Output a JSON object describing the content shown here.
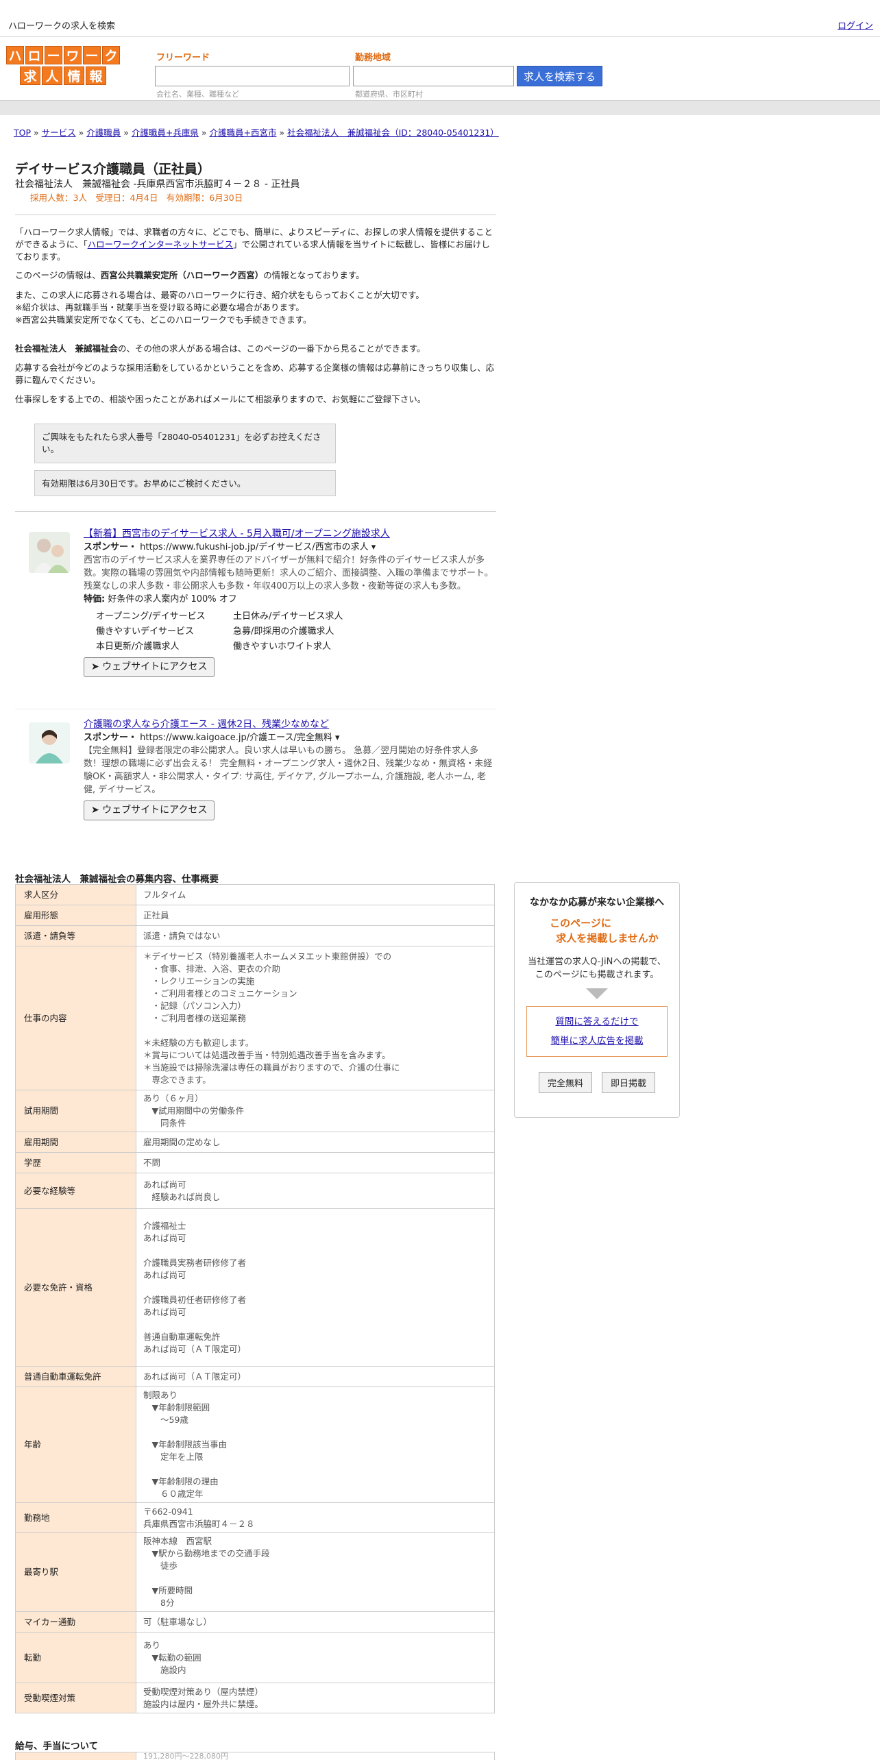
{
  "header": {
    "search_title": "ハローワークの求人を検索",
    "login": "ログイン"
  },
  "logo": {
    "row1": [
      "ハ",
      "ロ",
      "ー",
      "ワ",
      "ー",
      "ク"
    ],
    "row2": [
      "求",
      "人",
      "情",
      "報"
    ]
  },
  "search": {
    "keyword_label": "フリーワード",
    "keyword_hint": "会社名、業種、職種など",
    "area_label": "勤務地域",
    "area_hint": "都道府県、市区町村",
    "button": "求人を検索する"
  },
  "breadcrumb": {
    "items": [
      "TOP",
      "サービス",
      "介護職員",
      "介護職員+兵庫県",
      "介護職員+西宮市",
      "社会福祉法人　兼誠福祉会（ID：28040-05401231）"
    ],
    "sep": " » "
  },
  "job": {
    "title": "デイサービス介護職員（正社員）",
    "subtitle": "社会福祉法人　兼誠福祉会 -兵庫県西宮市浜脇町４－２８ - 正社員",
    "meta": "採用人数：3人　受理日：4月4日　有効期限：6月30日"
  },
  "intro": {
    "p1a": "「ハローワーク求人情報」では、求職者の方々に、どこでも、簡単に、よりスピーディに、お探しの求人情報を提供することができるように、「",
    "p1link": "ハローワークインターネットサービス",
    "p1b": "」で公開されている求人情報を当サイトに転載し、皆様にお届けしております。",
    "p2a": "このページの情報は、",
    "p2b": "西宮公共職業安定所（ハローワーク西宮）",
    "p2c": "の情報となっております。",
    "p3": "また、この求人に応募される場合は、最寄のハローワークに行き、紹介状をもらっておくことが大切です。",
    "p4": "※紹介状は、再就職手当・就業手当を受け取る時に必要な場合があります。",
    "p5": "※西宮公共職業安定所でなくても、どこのハローワークでも手続きできます。",
    "p6a": "社会福祉法人　兼誠福祉会",
    "p6b": "の、その他の求人がある場合は、このページの一番下から見ることができます。",
    "p7": "応募する会社が今どのような採用活動をしているかということを含め、応募する企業様の情報は応募前にきっちり収集し、応募に臨んでください。",
    "p8": "仕事探しをする上での、相談や困ったことがあればメールにて相談承りますので、お気軽にご登録下さい。"
  },
  "notices": [
    "ご興味をもたれたら求人番号「28040-05401231」を必ずお控えください。",
    "有効期限は6月30日です。お早めにご検討ください。"
  ],
  "ads": [
    {
      "title": "【新着】西宮市のデイサービス求人 - 5月入職可/オープニング施設求人",
      "sponsor_label": "スポンサー・",
      "sponsor_url": "https://www.fukushi-job.jp/デイサービス/西宮市の求人 ▾",
      "desc": "西宮市のデイサービス求人を業界専任のアドバイザーが無料で紹介！好条件のデイサービス求人が多数。実際の職場の雰囲気や内部情報も随時更新！求人のご紹介、面接調整、入職の準備までサポート。 残業なしの求人多数・非公開求人も多数・年収400万以上の求人多数・夜勤等従の求人も多数。",
      "feature_label": "特価:",
      "feature": " 好条件の求人案内が 100% オフ",
      "links": [
        "オープニング/デイサービス",
        "土日休み/デイサービス求人",
        "働きやすいデイサービス",
        "急募/即採用の介護職求人",
        "本日更新/介護職求人",
        "働きやすいホワイト求人"
      ],
      "button": "➤ ウェブサイトにアクセス"
    },
    {
      "title": "介護職の求人なら介護エース - 週休2日、残業少なめなど",
      "sponsor_label": "スポンサー・",
      "sponsor_url": "https://www.kaigoace.jp/介護エース/完全無料 ▾",
      "desc": "【完全無料】登録者限定の非公開求人。良い求人は早いもの勝ち。 急募／翌月開始の好条件求人多数！理想の職場に必ず出会える！ 完全無料・オープニング求人・週休2日、残業少なめ・無資格・未経験OK・高額求人・非公開求人・タイプ: サ高住, デイケア, グループホーム, 介護施設, 老人ホーム, 老健, デイサービス。",
      "button": "➤ ウェブサイトにアクセス"
    }
  ],
  "details_title": "社会福祉法人　兼誠福祉会の募集内容、仕事概要",
  "details": [
    {
      "k": "求人区分",
      "v": "フルタイム"
    },
    {
      "k": "雇用形態",
      "v": "正社員"
    },
    {
      "k": "派遣・請負等",
      "v": "派遣・請負ではない"
    },
    {
      "k": "仕事の内容",
      "v": "＊デイサービス（特別養護老人ホームメヌエット東館併設）での\n　・食事、排泄、入浴、更衣の介助\n　・レクリエーションの実施\n　・ご利用者様とのコミュニケーション\n　・記録（パソコン入力）\n　・ご利用者様の送迎業務\n\n＊未経験の方も歓迎します。\n＊賞与については処遇改善手当・特別処遇改善手当を含みます。\n＊当施設では掃除洗濯は専任の職員がおりますので、介護の仕事に\n　専念できます。"
    },
    {
      "k": "試用期間",
      "v": "あり（６ヶ月）\n　▼試用期間中の労働条件\n　　同条件"
    },
    {
      "k": "雇用期間",
      "v": "雇用期間の定めなし"
    },
    {
      "k": "学歴",
      "v": "不問"
    },
    {
      "k": "必要な経験等",
      "v": "あれば尚可\n　経験あれば尚良し"
    },
    {
      "k": "必要な免許・資格",
      "v": "介護福祉士\nあれば尚可\n\n介護職員実務者研修修了者\nあれば尚可\n\n介護職員初任者研修修了者\nあれば尚可\n\n普通自動車運転免許\nあれば尚可（ＡＴ限定可）"
    },
    {
      "k": "普通自動車運転免許",
      "v": "あれば尚可（ＡＴ限定可）"
    },
    {
      "k": "年齢",
      "v": "制限あり\n　▼年齢制限範囲\n　　〜59歳\n\n　▼年齢制限該当事由\n　　定年を上限\n\n　▼年齢制限の理由\n　　６０歳定年"
    },
    {
      "k": "勤務地",
      "v": "〒662-0941\n兵庫県西宮市浜脇町４－２８"
    },
    {
      "k": "最寄り駅",
      "v": "阪神本線　西宮駅\n　▼駅から勤務地までの交通手段\n　　徒歩\n\n　▼所要時間\n　　8分"
    },
    {
      "k": "マイカー通勤",
      "v": "可（駐車場なし）"
    },
    {
      "k": "転勤",
      "v": "あり\n　▼転勤の範囲\n　　施設内"
    },
    {
      "k": "受動喫煙対策",
      "v": "受動喫煙対策あり（屋内禁煙）\n施設内は屋内・屋外共に禁煙。"
    }
  ],
  "salary_title": "給与、手当について",
  "salary_first": "191,280円〜228,080円",
  "side": {
    "heading": "なかなか応募が来ない企業様へ",
    "orange1": "このページに",
    "orange2": "求人を掲載しませんか",
    "desc1": "当社運営の求人Q-JiNへの掲載で、",
    "desc2": "このページにも掲載されます。",
    "link1": "質問に答えるだけで",
    "link2": "簡単に求人広告を掲載",
    "btn1": "完全無料",
    "btn2": "即日掲載"
  }
}
